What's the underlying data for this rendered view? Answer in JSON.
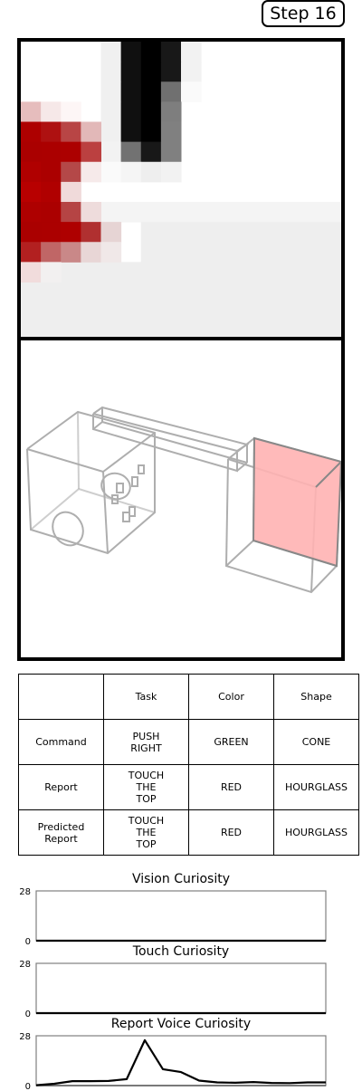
{
  "step_label": "Step 16",
  "table": {
    "header": [
      "",
      "Task",
      "Color",
      "Shape"
    ],
    "rows": [
      {
        "label": "Command",
        "task": "PUSH\nRIGHT",
        "color": "GREEN",
        "shape": "CONE"
      },
      {
        "label": "Report",
        "task": "TOUCH\nTHE\nTOP",
        "color": "RED",
        "shape": "HOURGLASS"
      },
      {
        "label": "Predicted\nReport",
        "task": "TOUCH\nTHE\nTOP",
        "color": "RED",
        "shape": "HOURGLASS"
      }
    ]
  },
  "colors": {
    "object_highlight": "#ffb3b3",
    "vision_red": "#b80000"
  },
  "chart_data": [
    {
      "type": "line",
      "title": "Vision Curiosity",
      "ylim": [
        0,
        28
      ],
      "yticks": [
        "28",
        "0"
      ],
      "values": [
        0,
        0,
        0,
        0,
        0,
        0,
        0,
        0,
        0,
        0,
        0,
        0,
        0,
        0,
        0,
        0,
        0
      ]
    },
    {
      "type": "line",
      "title": "Touch Curiosity",
      "ylim": [
        0,
        28
      ],
      "yticks": [
        "28",
        "0"
      ],
      "values": [
        0,
        0,
        0,
        0,
        0,
        0,
        0,
        0,
        0,
        0,
        0,
        0,
        0,
        0,
        0,
        0,
        0
      ]
    },
    {
      "type": "line",
      "title": "Report Voice Curiosity",
      "ylim": [
        0,
        28
      ],
      "yticks": [
        "28",
        "0"
      ],
      "values": [
        0.2,
        1,
        2.5,
        2.5,
        2.6,
        3.6,
        25.5,
        9.2,
        7.6,
        2.8,
        1.8,
        1.6,
        2.0,
        1.5,
        1.4,
        1.8,
        1.8
      ]
    }
  ]
}
